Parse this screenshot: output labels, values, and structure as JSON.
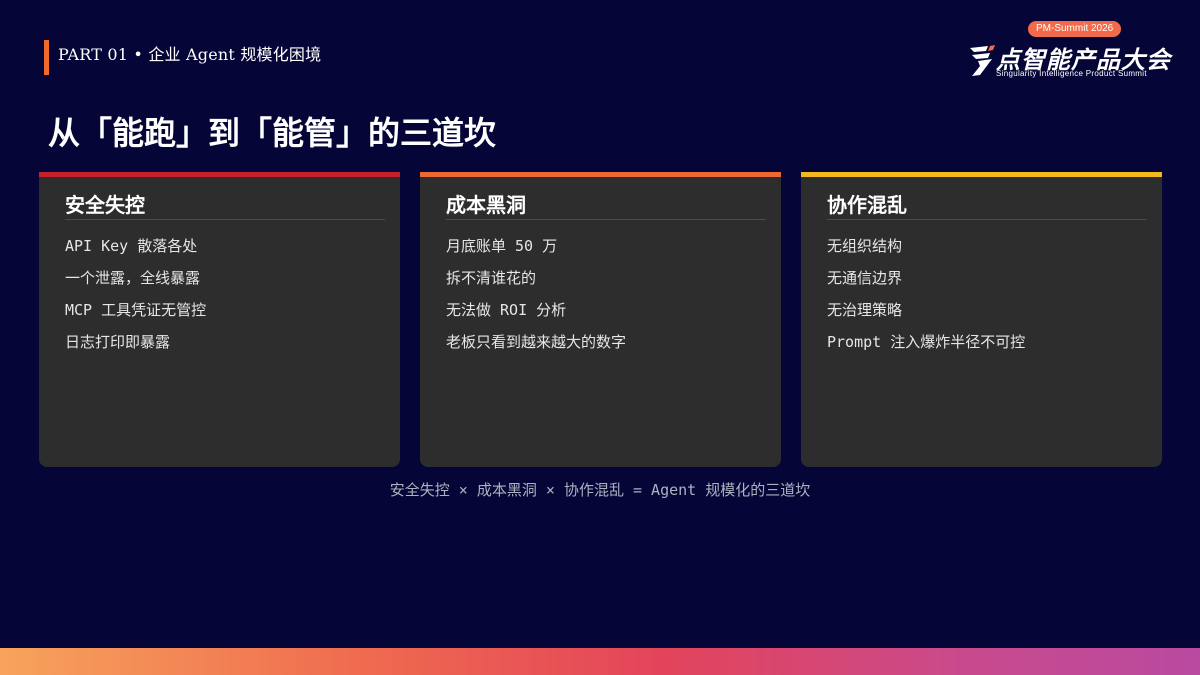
{
  "header": {
    "part_label": "PART 01 • 企业 Agent 规模化困境"
  },
  "logo": {
    "badge": "PM-Summit 2026",
    "title": "点智能产品大会",
    "subtitle": "Singularity Intelligence Product Summit"
  },
  "page_title": "从「能跑」到「能管」的三道坎",
  "cards": [
    {
      "title": "安全失控",
      "accent": "#c8202a",
      "items": [
        "API Key 散落各处",
        "一个泄露，全线暴露",
        "MCP 工具凭证无管控",
        "日志打印即暴露"
      ]
    },
    {
      "title": "成本黑洞",
      "accent": "#ec6a32",
      "items": [
        "月底账单 50 万",
        "拆不清谁花的",
        "无法做 ROI 分析",
        "老板只看到越来越大的数字"
      ]
    },
    {
      "title": "协作混乱",
      "accent": "#f3b81c",
      "items": [
        "无组织结构",
        "无通信边界",
        "无治理策略",
        "Prompt 注入爆炸半径不可控"
      ]
    }
  ],
  "formula": "安全失控 × 成本黑洞 × 协作混乱 = Agent 规模化的三道坎",
  "colors": {
    "background": "#050637",
    "part_accent": "#f26a2b",
    "card_bg": "#2d2d2d"
  }
}
